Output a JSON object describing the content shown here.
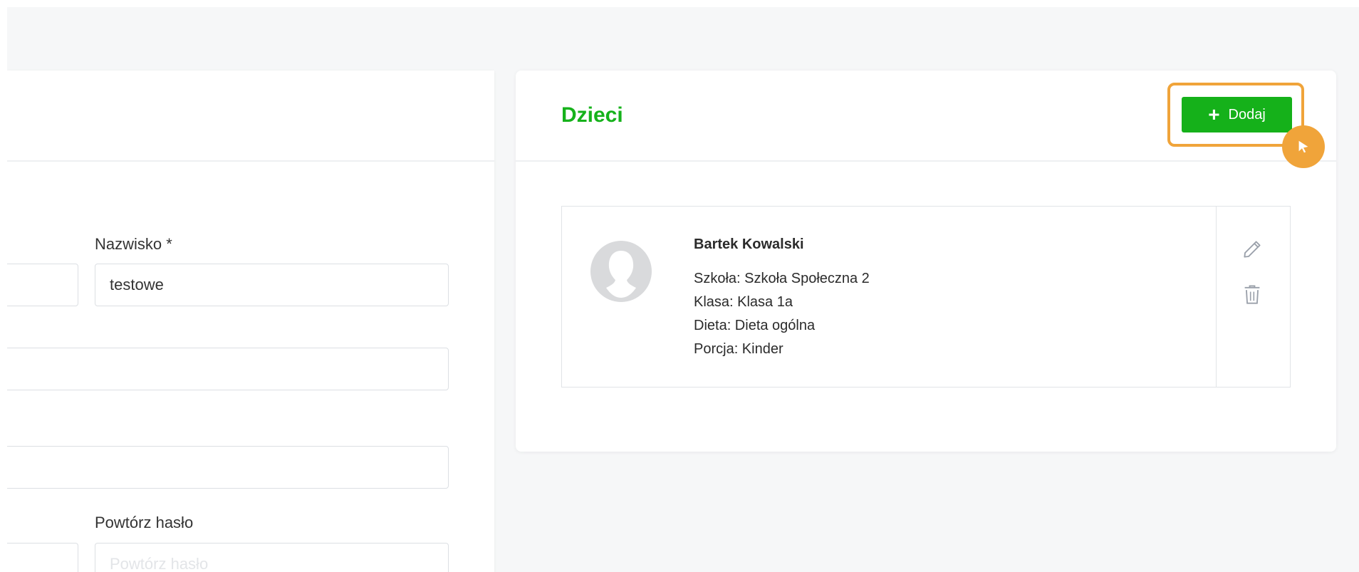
{
  "form": {
    "last_name_label": "Nazwisko *",
    "last_name_value": "testowe",
    "repeat_password_label": "Powtórz hasło",
    "repeat_password_placeholder": "Powtórz hasło"
  },
  "children_card": {
    "title": "Dzieci",
    "add_button_label": "Dodaj",
    "children": [
      {
        "name": "Bartek Kowalski",
        "school": "Szkoła: Szkoła Społeczna 2",
        "class": "Klasa: Klasa 1a",
        "diet": "Dieta: Dieta ogólna",
        "portion": "Porcja: Kinder"
      }
    ]
  },
  "icons": {
    "add": "plus-icon",
    "edit": "pencil-icon",
    "delete": "trash-icon",
    "avatar": "user-silhouette-icon",
    "cursor": "cursor-icon"
  },
  "colors": {
    "accent_green": "#15b11a",
    "title_green": "#16b21b",
    "highlight_orange": "#f0a43a",
    "icon_grey": "#9aa0aa",
    "background": "#f6f7f8"
  }
}
